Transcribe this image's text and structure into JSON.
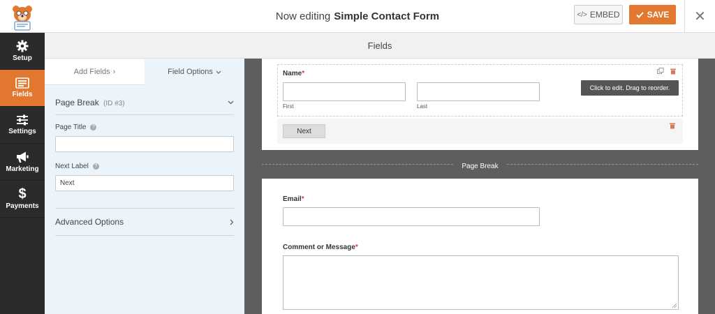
{
  "header": {
    "title_prefix": "Now editing",
    "form_name": "Simple Contact Form",
    "embed_label": "EMBED",
    "save_label": "SAVE",
    "close_symbol": "✕"
  },
  "sidebar": {
    "items": [
      {
        "label": "Setup",
        "icon": "gear-icon"
      },
      {
        "label": "Fields",
        "icon": "fields-icon",
        "active": true
      },
      {
        "label": "Settings",
        "icon": "sliders-icon"
      },
      {
        "label": "Marketing",
        "icon": "megaphone-icon"
      },
      {
        "label": "Payments",
        "icon": "dollar-icon"
      }
    ]
  },
  "panel": {
    "title": "Fields",
    "tabs": [
      {
        "label": "Add Fields",
        "arrow": "›"
      },
      {
        "label": "Field Options",
        "arrow": "⌄"
      }
    ],
    "options": {
      "section_title": "Page Break",
      "section_id": "(ID #3)",
      "page_title_label": "Page Title",
      "page_title_value": "",
      "next_label_label": "Next Label",
      "next_label_value": "Next",
      "advanced_label": "Advanced Options"
    }
  },
  "preview": {
    "name_label": "Name",
    "required_mark": "*",
    "first_sub": "First",
    "last_sub": "Last",
    "tooltip": "Click to edit. Drag to reorder.",
    "next_button": "Next",
    "page_break_label": "Page Break",
    "email_label": "Email",
    "comment_label": "Comment or Message"
  },
  "colors": {
    "accent": "#e27730",
    "sidebar_bg": "#2b2b2b",
    "options_bg": "#ebf3fb",
    "preview_bg": "#5e5e5e",
    "required": "#d63638"
  }
}
